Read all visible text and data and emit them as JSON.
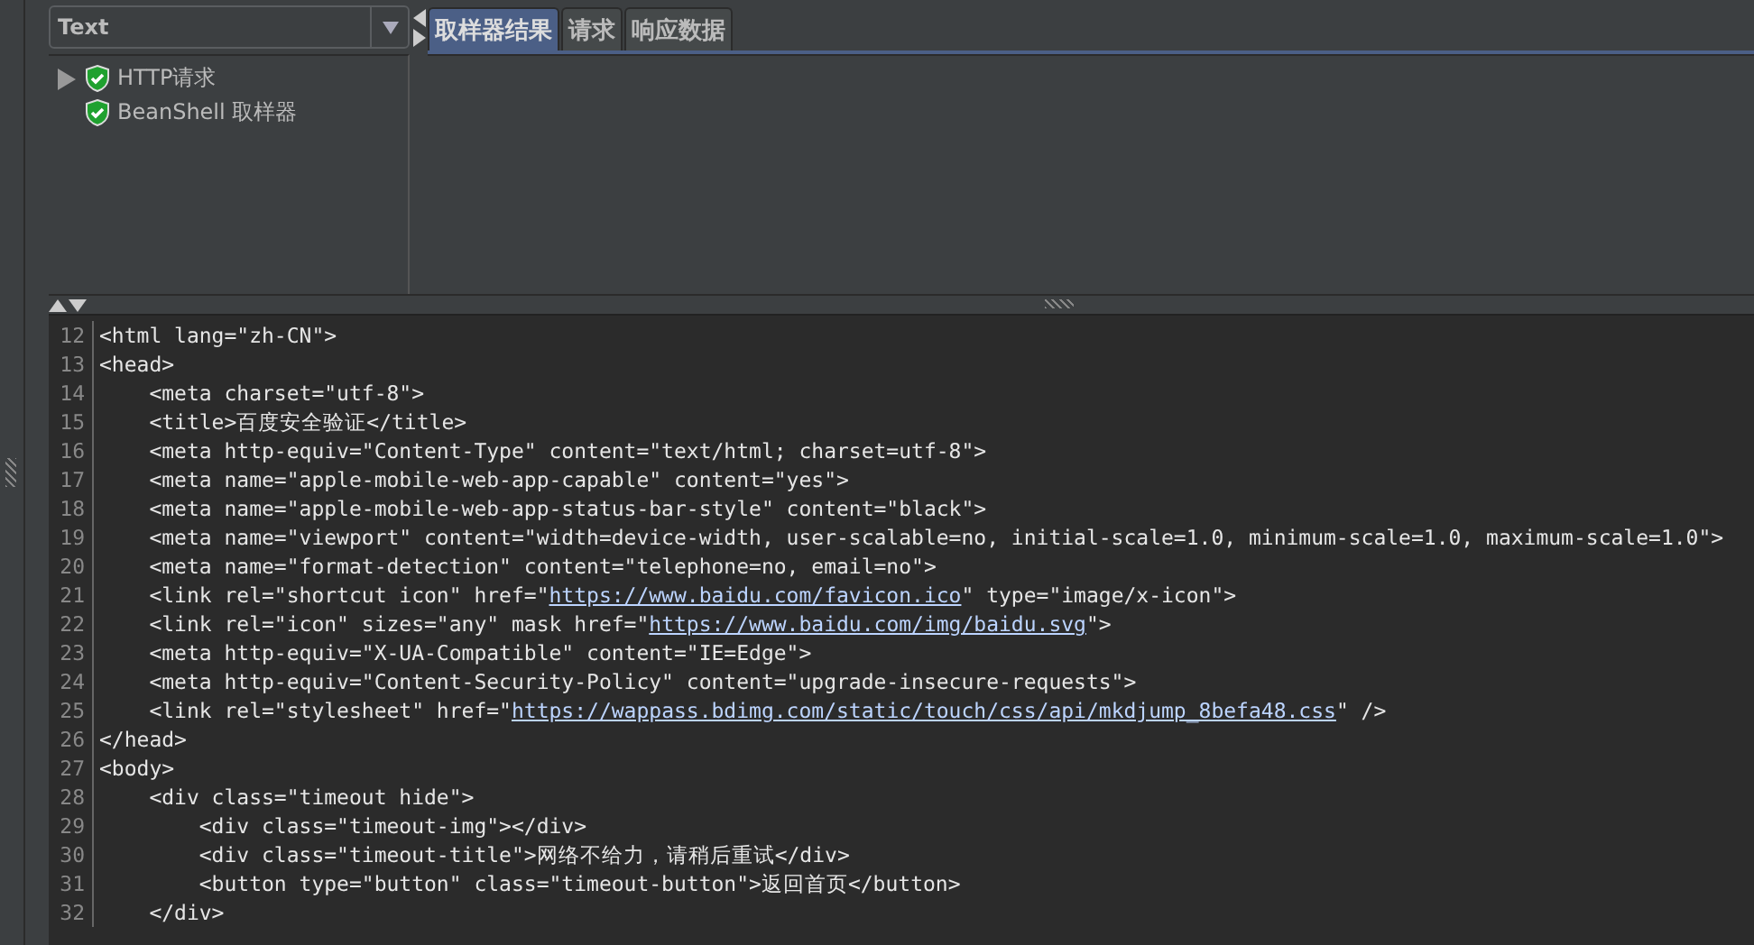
{
  "filter_combo": {
    "value": "Text"
  },
  "result_tree": [
    {
      "label": "HTTP请求",
      "expandable": true,
      "expanded": false
    },
    {
      "label": "BeanShell 取样器",
      "expandable": false
    }
  ],
  "tabs": [
    {
      "label": "取样器结果",
      "selected": true
    },
    {
      "label": "请求",
      "selected": false
    },
    {
      "label": "响应数据",
      "selected": false
    }
  ],
  "code_lines": [
    {
      "number": "12",
      "parts": [
        {
          "text": "<html lang=\"zh-CN\">"
        }
      ]
    },
    {
      "number": "13",
      "parts": [
        {
          "text": "<head>"
        }
      ]
    },
    {
      "number": "14",
      "parts": [
        {
          "text": "    <meta charset=\"utf-8\">"
        }
      ]
    },
    {
      "number": "15",
      "parts": [
        {
          "text": "    <title>百度安全验证</title>"
        }
      ]
    },
    {
      "number": "16",
      "parts": [
        {
          "text": "    <meta http-equiv=\"Content-Type\" content=\"text/html; charset=utf-8\">"
        }
      ]
    },
    {
      "number": "17",
      "parts": [
        {
          "text": "    <meta name=\"apple-mobile-web-app-capable\" content=\"yes\">"
        }
      ]
    },
    {
      "number": "18",
      "parts": [
        {
          "text": "    <meta name=\"apple-mobile-web-app-status-bar-style\" content=\"black\">"
        }
      ]
    },
    {
      "number": "19",
      "parts": [
        {
          "text": "    <meta name=\"viewport\" content=\"width=device-width, user-scalable=no, initial-scale=1.0, minimum-scale=1.0, maximum-scale=1.0\">"
        }
      ]
    },
    {
      "number": "20",
      "parts": [
        {
          "text": "    <meta name=\"format-detection\" content=\"telephone=no, email=no\">"
        }
      ]
    },
    {
      "number": "21",
      "parts": [
        {
          "text": "    <link rel=\"shortcut icon\" href=\""
        },
        {
          "text": "https://www.baidu.com/favicon.ico",
          "kind": "link"
        },
        {
          "text": "\" type=\"image/x-icon\">"
        }
      ]
    },
    {
      "number": "22",
      "parts": [
        {
          "text": "    <link rel=\"icon\" sizes=\"any\" mask href=\""
        },
        {
          "text": "https://www.baidu.com/img/baidu.svg",
          "kind": "link"
        },
        {
          "text": "\">"
        }
      ]
    },
    {
      "number": "23",
      "parts": [
        {
          "text": "    <meta http-equiv=\"X-UA-Compatible\" content=\"IE=Edge\">"
        }
      ]
    },
    {
      "number": "24",
      "parts": [
        {
          "text": "    <meta http-equiv=\"Content-Security-Policy\" content=\"upgrade-insecure-requests\">"
        }
      ]
    },
    {
      "number": "25",
      "parts": [
        {
          "text": "    <link rel=\"stylesheet\" href=\""
        },
        {
          "text": "https://wappass.bdimg.com/static/touch/css/api/mkdjump_8befa48.css",
          "kind": "link"
        },
        {
          "text": "\" />"
        }
      ]
    },
    {
      "number": "26",
      "parts": [
        {
          "text": "</head>"
        }
      ]
    },
    {
      "number": "27",
      "parts": [
        {
          "text": "<body>"
        }
      ]
    },
    {
      "number": "28",
      "parts": [
        {
          "text": "    <div class=\"timeout hide\">"
        }
      ]
    },
    {
      "number": "29",
      "parts": [
        {
          "text": "        <div class=\"timeout-img\"></div>"
        }
      ]
    },
    {
      "number": "30",
      "parts": [
        {
          "text": "        <div class=\"timeout-title\">网络不给力，请稍后重试</div>"
        }
      ]
    },
    {
      "number": "31",
      "parts": [
        {
          "text": "        <button type=\"button\" class=\"timeout-button\">返回首页</button>"
        }
      ]
    },
    {
      "number": "32",
      "parts": [
        {
          "text": "    </div>"
        }
      ]
    }
  ]
}
